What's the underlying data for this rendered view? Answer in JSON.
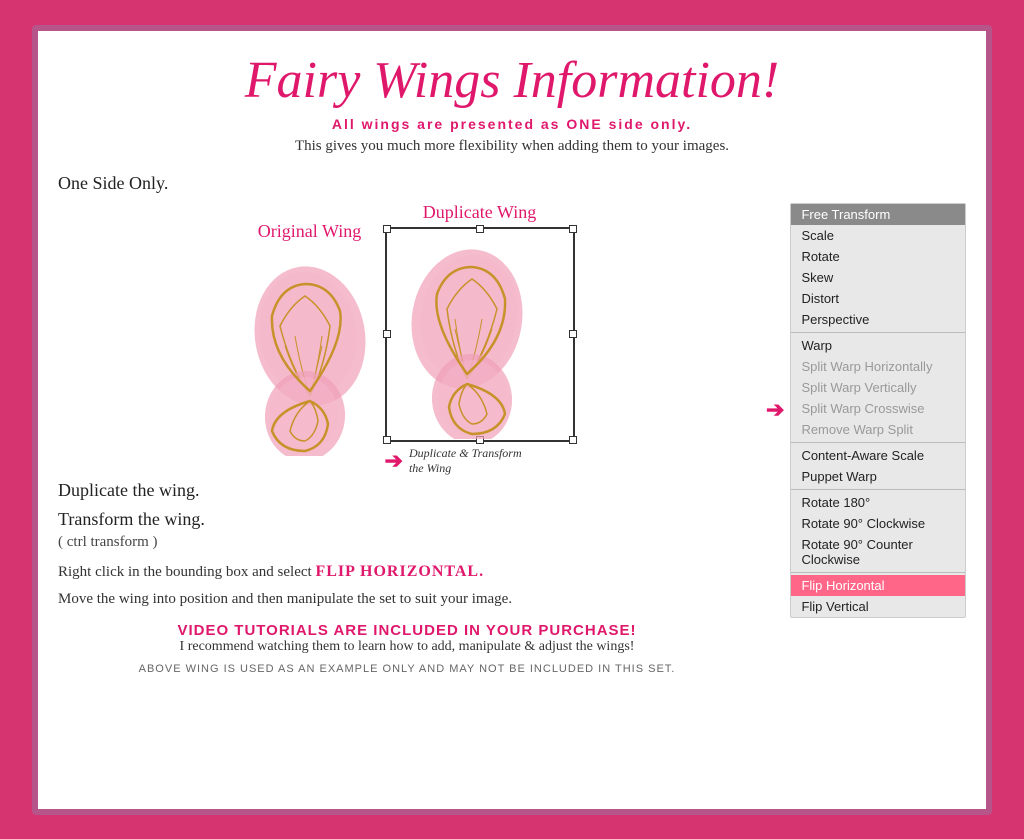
{
  "title": "Fairy Wings Information!",
  "subtitle": {
    "text": "All wings are presented as",
    "emphasis": "ONE",
    "text2": "side only."
  },
  "description": "This gives you much more flexibility when adding them to your images.",
  "steps": {
    "step1": "One Side Only.",
    "step2": "Duplicate the wing.",
    "step3": "Transform the wing.",
    "step3sub": "( ctrl transform )",
    "wing_label_original": "Original Wing",
    "wing_label_duplicate": "Duplicate Wing",
    "duplicate_transform_label": "Duplicate & Transform\nthe Wing"
  },
  "flip_instruction": {
    "text1": "Right click in the bounding box and select",
    "highlight": "FLIP HORIZONTAL."
  },
  "move_instruction": "Move the wing into position and then manipulate the set to\nsuit your image.",
  "video": {
    "title": "VIDEO TUTORIALS ARE INCLUDED IN YOUR PURCHASE!",
    "subtitle": "I recommend watching them to learn how to add, manipulate & adjust the wings!"
  },
  "footer": "ABOVE WING IS USED AS AN EXAMPLE ONLY AND MAY NOT BE INCLUDED IN THIS SET.",
  "menu": {
    "items": [
      {
        "label": "Free Transform",
        "state": "active"
      },
      {
        "label": "Scale",
        "state": "normal"
      },
      {
        "label": "Rotate",
        "state": "normal"
      },
      {
        "label": "Skew",
        "state": "normal"
      },
      {
        "label": "Distort",
        "state": "normal"
      },
      {
        "label": "Perspective",
        "state": "normal"
      },
      {
        "label": "divider",
        "state": "divider"
      },
      {
        "label": "Warp",
        "state": "normal"
      },
      {
        "label": "Split Warp Horizontally",
        "state": "grayed"
      },
      {
        "label": "Split Warp Vertically",
        "state": "grayed"
      },
      {
        "label": "Split Warp Crosswise",
        "state": "grayed"
      },
      {
        "label": "Remove Warp Split",
        "state": "grayed"
      },
      {
        "label": "divider2",
        "state": "divider"
      },
      {
        "label": "Content-Aware Scale",
        "state": "normal"
      },
      {
        "label": "Puppet Warp",
        "state": "normal"
      },
      {
        "label": "divider3",
        "state": "divider"
      },
      {
        "label": "Rotate 180°",
        "state": "normal"
      },
      {
        "label": "Rotate 90° Clockwise",
        "state": "normal"
      },
      {
        "label": "Rotate 90° Counter Clockwise",
        "state": "normal"
      },
      {
        "label": "divider4",
        "state": "divider"
      },
      {
        "label": "Flip Horizontal",
        "state": "highlighted"
      },
      {
        "label": "Flip Vertical",
        "state": "normal"
      }
    ]
  }
}
